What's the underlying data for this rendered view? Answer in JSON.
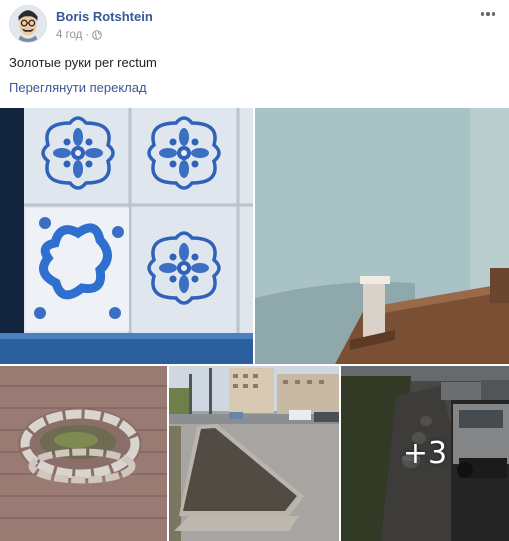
{
  "post": {
    "author": "Boris Rotshtein",
    "time": "4 год",
    "separator": "·",
    "text": "Золотые руки per rectum",
    "translate_link": "Переглянути переклад"
  },
  "icons": {
    "avatar": "cartoon-avatar",
    "privacy": "globe-icon",
    "menu": "more-dots-icon"
  },
  "photos": {
    "items": [
      {
        "subject": "blue-and-white-tiles"
      },
      {
        "subject": "stairwell-handrail"
      },
      {
        "subject": "paving-stones-circle"
      },
      {
        "subject": "parking-lot-flowerbed"
      },
      {
        "subject": "sidewalk-with-bollards"
      }
    ],
    "more_count": "+3"
  },
  "colors": {
    "link": "#385898",
    "text": "#1c1e21",
    "meta": "#90949c"
  }
}
